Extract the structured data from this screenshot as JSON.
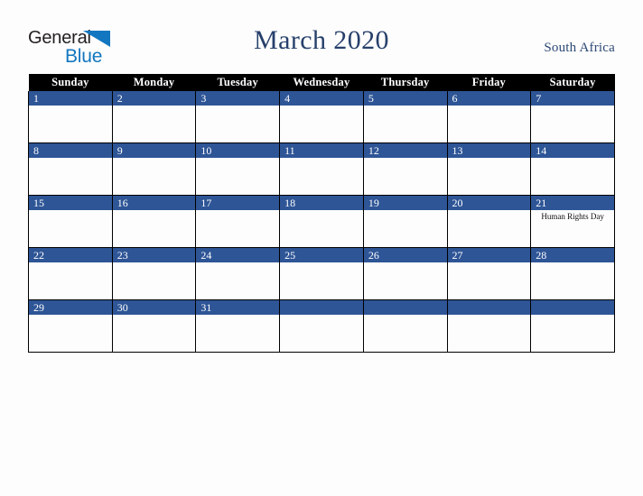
{
  "brand": {
    "name_part1": "General",
    "name_part2": "Blue",
    "triangle_color": "#1277c0",
    "text_color": "#231f20"
  },
  "header": {
    "title": "March 2020",
    "country": "South Africa",
    "title_color": "#27406b"
  },
  "calendar": {
    "weekday_headers": [
      "Sunday",
      "Monday",
      "Tuesday",
      "Wednesday",
      "Thursday",
      "Friday",
      "Saturday"
    ],
    "header_bg": "#000000",
    "header_text_color": "#ffffff",
    "daynum_bg": "#2e5596",
    "daynum_text_color": "#ffffff",
    "weeks": [
      [
        {
          "day": "1",
          "events": []
        },
        {
          "day": "2",
          "events": []
        },
        {
          "day": "3",
          "events": []
        },
        {
          "day": "4",
          "events": []
        },
        {
          "day": "5",
          "events": []
        },
        {
          "day": "6",
          "events": []
        },
        {
          "day": "7",
          "events": []
        }
      ],
      [
        {
          "day": "8",
          "events": []
        },
        {
          "day": "9",
          "events": []
        },
        {
          "day": "10",
          "events": []
        },
        {
          "day": "11",
          "events": []
        },
        {
          "day": "12",
          "events": []
        },
        {
          "day": "13",
          "events": []
        },
        {
          "day": "14",
          "events": []
        }
      ],
      [
        {
          "day": "15",
          "events": []
        },
        {
          "day": "16",
          "events": []
        },
        {
          "day": "17",
          "events": []
        },
        {
          "day": "18",
          "events": []
        },
        {
          "day": "19",
          "events": []
        },
        {
          "day": "20",
          "events": []
        },
        {
          "day": "21",
          "events": [
            "Human Rights Day"
          ]
        }
      ],
      [
        {
          "day": "22",
          "events": []
        },
        {
          "day": "23",
          "events": []
        },
        {
          "day": "24",
          "events": []
        },
        {
          "day": "25",
          "events": []
        },
        {
          "day": "26",
          "events": []
        },
        {
          "day": "27",
          "events": []
        },
        {
          "day": "28",
          "events": []
        }
      ],
      [
        {
          "day": "29",
          "events": []
        },
        {
          "day": "30",
          "events": []
        },
        {
          "day": "31",
          "events": []
        },
        {
          "day": "",
          "events": []
        },
        {
          "day": "",
          "events": []
        },
        {
          "day": "",
          "events": []
        },
        {
          "day": "",
          "events": []
        }
      ]
    ]
  }
}
